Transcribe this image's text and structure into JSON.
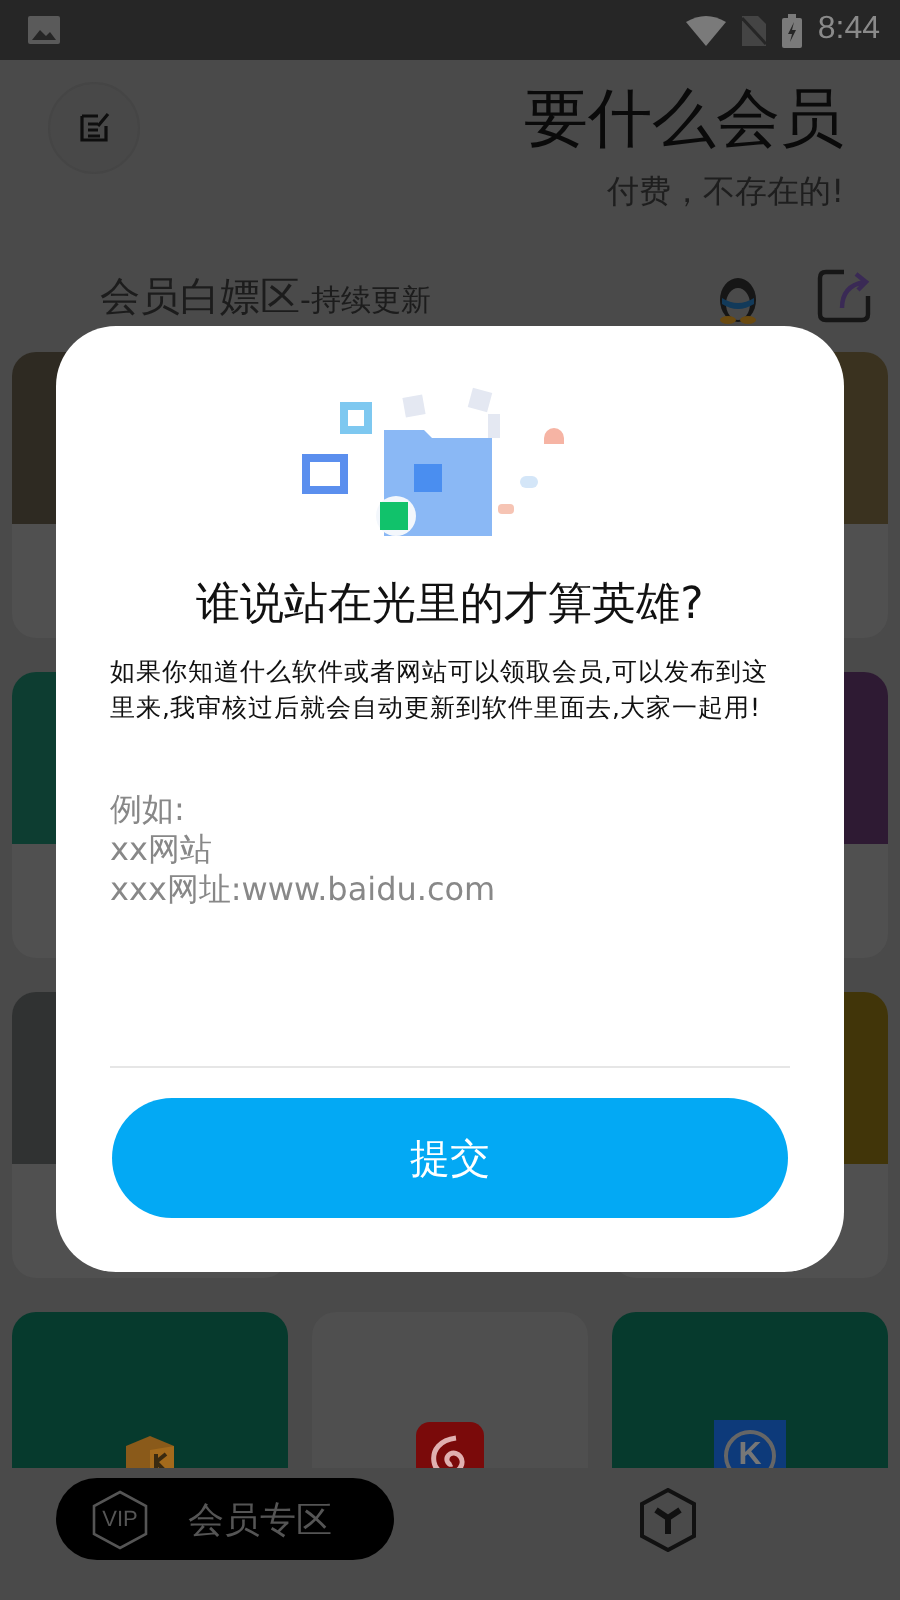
{
  "status_bar": {
    "time": "8:44"
  },
  "header": {
    "title": "要什么会员",
    "subtitle": "付费，不存在的!"
  },
  "section": {
    "title": "会员白嫖区",
    "tag": "-持续更新"
  },
  "cards": [
    {
      "kind": "text",
      "color": "#2e2a22"
    },
    {
      "kind": "covered"
    },
    {
      "kind": "text",
      "color": "#3a321f"
    },
    {
      "kind": "text",
      "color": "#0d3d31"
    },
    {
      "kind": "covered"
    },
    {
      "kind": "text",
      "color": "#2e1a33"
    },
    {
      "kind": "text",
      "color": "#303232"
    },
    {
      "kind": "covered"
    },
    {
      "kind": "text",
      "color": "#413509"
    },
    {
      "kind": "box-logo",
      "color": "#063a2d"
    },
    {
      "kind": "swirl-logo",
      "color": "#4f4f4f"
    },
    {
      "kind": "letter-logo",
      "color": "#063a2d",
      "logo_text": "K"
    }
  ],
  "dialog": {
    "title": "谁说站在光里的才算英雄?",
    "message": "如果你知道什么软件或者网站可以领取会员,可以发布到这里来,我审核过后就会自动更新到软件里面去,大家一起用!",
    "input": {
      "placeholder": "例如:\nxx网站\nxxx网址:www.baidu.com"
    },
    "submit": "提交"
  },
  "bottom_nav": {
    "vip_label": "VIP",
    "tab_label": "会员专区"
  }
}
